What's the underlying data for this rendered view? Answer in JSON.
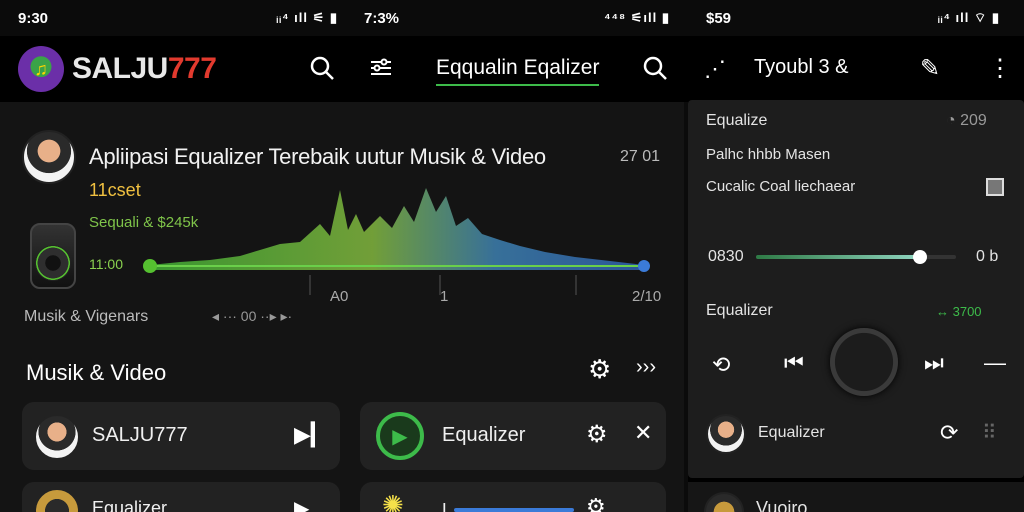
{
  "status": {
    "left_time": "9:30",
    "left_signal": "ᵢᵢ⁴ ıll ⚟ ▮",
    "mid_time": "7:3%",
    "mid_signal": "⁴⁴⁸ ⚟ıll ▮",
    "right_time": "$59",
    "right_signal": "ᵢᵢ⁴ ıll ⌔ ▮"
  },
  "header": {
    "brand_a": "SALJU",
    "brand_b": "777",
    "tab_label": "Eqqualin Eqalizer"
  },
  "now_playing": {
    "title": "Apliipasi Equalizer Terebaik uutur Musik & Video",
    "time_right": "27 01",
    "subtitle": "11cset",
    "meta": "Sequali & $245k",
    "timeline_start": "11:00",
    "tick_a": "A0",
    "tick_b": "1",
    "tick_c": "2/10",
    "progress": 0.0
  },
  "secondary_row": {
    "label": "Musik & Vigenars",
    "time": "00"
  },
  "section": {
    "title": "Musik & Video"
  },
  "list": {
    "item1_label": "SALJU777",
    "item2_label": "Equalizer",
    "item3_label": "Equalizer",
    "item4_label": "L"
  },
  "right_panel": {
    "header_title": "Tyoubl 3 &",
    "row1_label": "Equalize",
    "row1_value": "209",
    "row2_label": "Palhc hhbb Masen",
    "row3_label": "Cucalic Coal liechaear",
    "slider_left": "0830",
    "slider_right": "0 b",
    "slider_level": 0.82,
    "eq_label": "Equalizer",
    "eq_value": "↔ 3700",
    "bottom_label": "Equalizer",
    "bottom_strip_label": "Vuoiro"
  },
  "colors": {
    "accent_green": "#55c030",
    "accent_blue": "#3b7bd8",
    "brand_red": "#e23a2e"
  }
}
